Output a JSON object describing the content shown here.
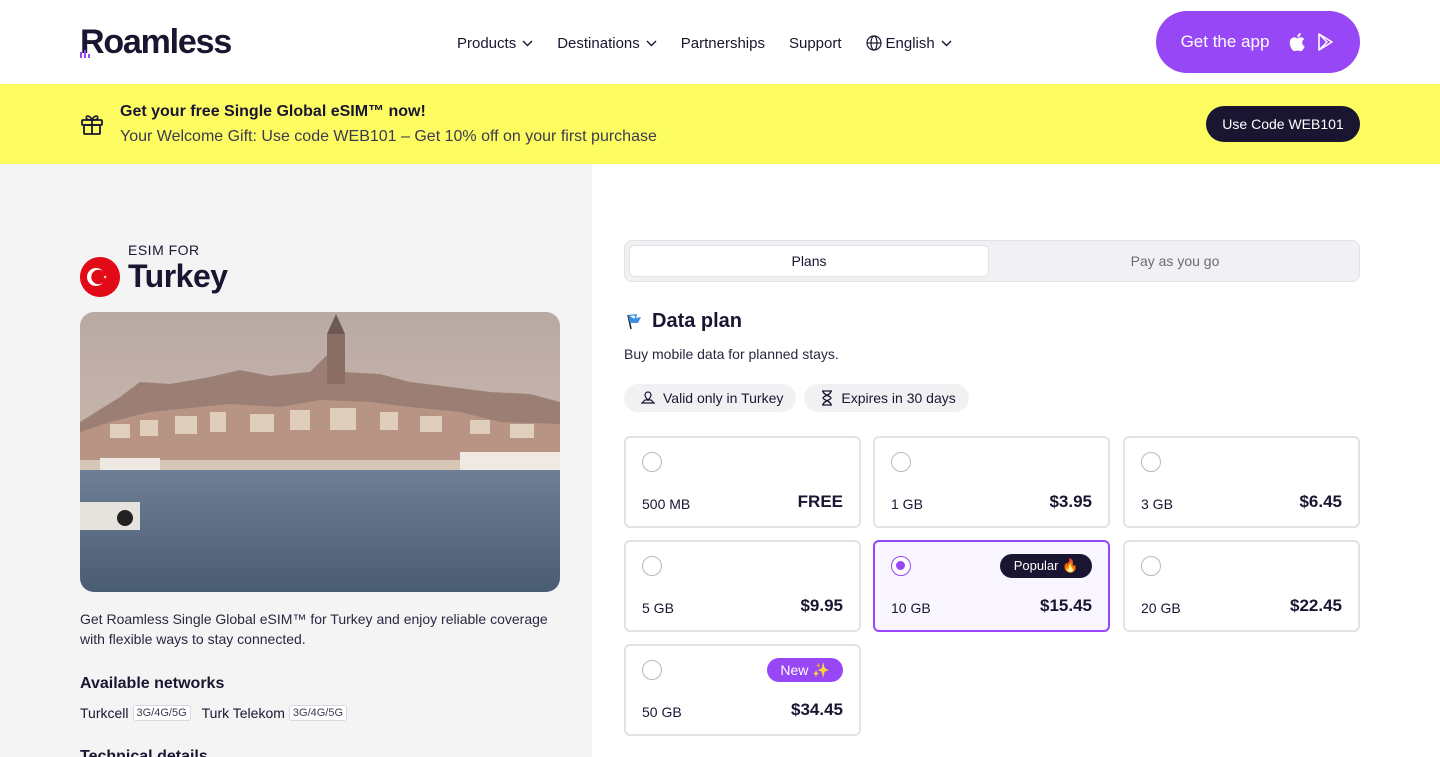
{
  "header": {
    "logo": "Roamless",
    "nav": [
      {
        "label": "Products"
      },
      {
        "label": "Destinations"
      },
      {
        "label": "Partnerships"
      },
      {
        "label": "Support"
      },
      {
        "label": "English"
      }
    ],
    "get_app_label": "Get the app"
  },
  "banner": {
    "title": "Get your free Single Global eSIM™ now!",
    "subtitle": "Your Welcome Gift: Use code WEB101 – Get 10% off on your first purchase",
    "code_button": "Use Code WEB101"
  },
  "left": {
    "esim_for": "ESIM FOR",
    "country": "Turkey",
    "description": "Get Roamless Single Global eSIM™ for Turkey and enjoy reliable coverage with flexible ways to stay connected.",
    "networks_title": "Available networks",
    "networks": [
      {
        "name": "Turkcell",
        "tech": "3G/4G/5G"
      },
      {
        "name": "Turk Telekom",
        "tech": "3G/4G/5G"
      }
    ],
    "technical_title": "Technical details"
  },
  "tabs": {
    "plans": "Plans",
    "payg": "Pay as you go"
  },
  "data_plan": {
    "title": "Data plan",
    "subtitle": "Buy mobile data for planned stays.",
    "chip_valid": "Valid only in Turkey",
    "chip_expires": "Expires in 30 days",
    "plans": [
      {
        "size": "500 MB",
        "price": "FREE"
      },
      {
        "size": "1 GB",
        "price": "$3.95"
      },
      {
        "size": "3 GB",
        "price": "$6.45"
      },
      {
        "size": "5 GB",
        "price": "$9.95"
      },
      {
        "size": "10 GB",
        "price": "$15.45",
        "badge": "Popular 🔥",
        "selected": true
      },
      {
        "size": "20 GB",
        "price": "$22.45"
      },
      {
        "size": "50 GB",
        "price": "$34.45",
        "badge": "New ✨"
      }
    ]
  },
  "colors": {
    "accent": "#9747f5",
    "banner": "#fdfd62",
    "dark": "#1a1530"
  }
}
